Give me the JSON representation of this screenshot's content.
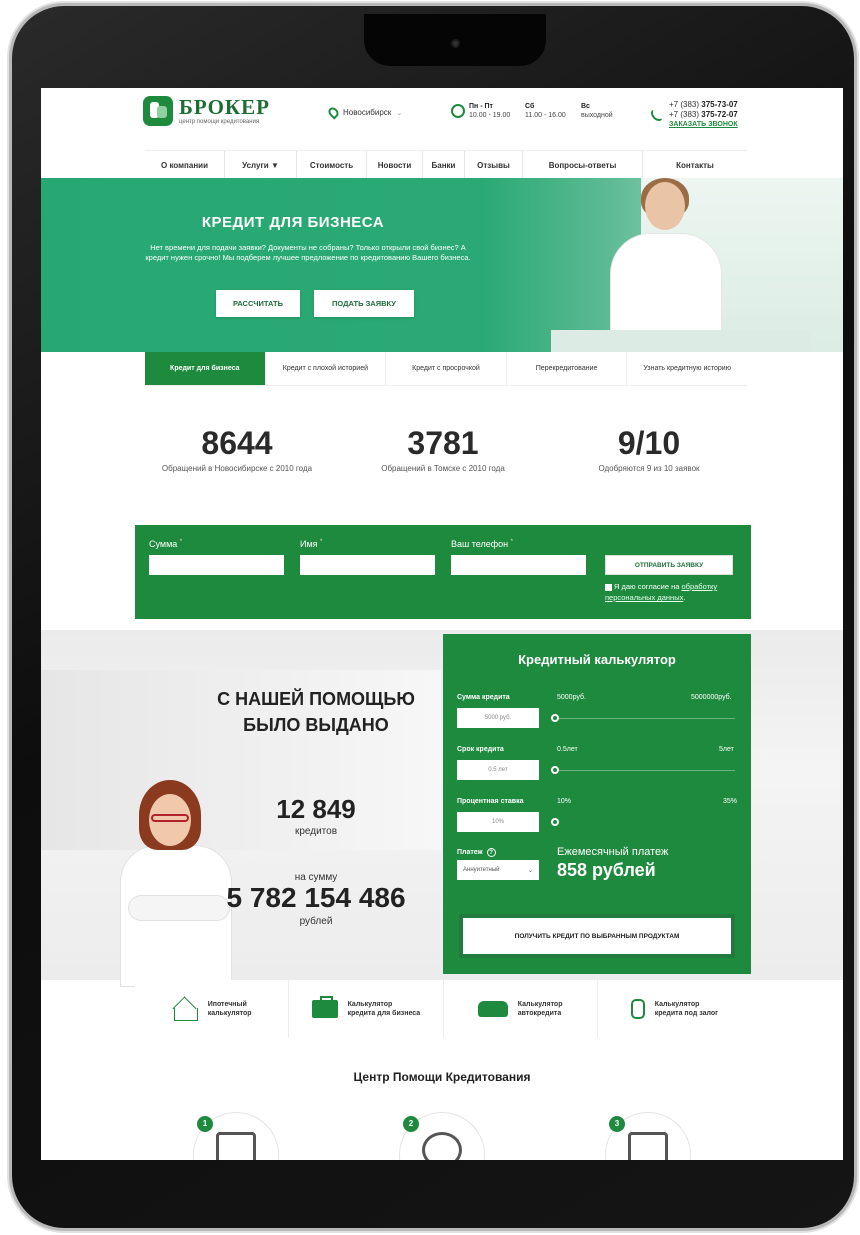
{
  "header": {
    "logo_name": "БРОКЕР",
    "logo_sub": "центр помощи кредитования",
    "city": "Новосибирск",
    "schedule": [
      {
        "day": "Пн - Пт",
        "hours": "10.00 - 19.00"
      },
      {
        "day": "Сб",
        "hours": "11.00 - 16.00"
      },
      {
        "day": "Вс",
        "hours": "выходной"
      }
    ],
    "phone1_prefix": "+7 (383)",
    "phone1": "375-73-07",
    "phone2_prefix": "+7 (383)",
    "phone2": "375-72-07",
    "callback": "ЗАКАЗАТЬ ЗВОНОК"
  },
  "nav": [
    "О компании",
    "Услуги ▼",
    "Стоимость",
    "Новости",
    "Банки",
    "Отзывы",
    "Вопросы-ответы",
    "Контакты"
  ],
  "hero": {
    "title": "КРЕДИТ ДЛЯ БИЗНЕСА",
    "text": "Нет времени для подачи заявки? Документы не собраны? Только открыли свой бизнес? А кредит нужен срочно! Мы подберем лучшее предложение по кредитованию Вашего бизнеса.",
    "btn_calc": "РАССЧИТАТЬ",
    "btn_apply": "ПОДАТЬ ЗАЯВКУ"
  },
  "tabs": [
    "Кредит для бизнеса",
    "Кредит с плохой историей",
    "Кредит с просрочкой",
    "Перекредитование",
    "Узнать кредитную историю"
  ],
  "stats": [
    {
      "num": "8644",
      "label": "Обращений в Новосибирске с 2010 года"
    },
    {
      "num": "3781",
      "label": "Обращений в Томске с 2010 года"
    },
    {
      "num": "9/10",
      "label": "Одобряются 9 из 10 заявок"
    }
  ],
  "form": {
    "sum_label": "Сумма",
    "name_label": "Имя",
    "phone_label": "Ваш телефон",
    "required": "*",
    "submit": "ОТПРАВИТЬ ЗАЯВКУ",
    "agree_text": "Я даю согласие на ",
    "agree_link": "обработку персональных данных",
    "agree_end": "."
  },
  "issued": {
    "title": "С НАШЕЙ ПОМОЩЬЮ БЫЛО ВЫДАНО",
    "credits_num": "12 849",
    "credits_lbl": "кредитов",
    "sum_lbl": "на сумму",
    "sum_num": "5 782 154 486",
    "rub_lbl": "рублей"
  },
  "calc": {
    "title": "Кредитный калькулятор",
    "amount_label": "Сумма кредита",
    "amount_min": "5000руб.",
    "amount_max": "5000000руб.",
    "amount_value": "5000 руб.",
    "term_label": "Срок кредита",
    "term_min": "0.5лет",
    "term_max": "5лет",
    "term_value": "0.5 лет",
    "rate_label": "Процентная ставка",
    "rate_min": "10%",
    "rate_max": "35%",
    "rate_value": "10%",
    "payment_label": "Платеж",
    "payment_type": "Аннуитетный",
    "monthly_label": "Ежемесячный платеж",
    "monthly_value": "858 рублей",
    "cta": "ПОЛУЧИТЬ КРЕДИТ ПО ВЫБРАННЫМ ПРОДУКТАМ"
  },
  "bottom_links": [
    {
      "l1": "Ипотечный",
      "l2": "калькулятор",
      "icon": "house-icon"
    },
    {
      "l1": "Калькулятор",
      "l2": "кредита для бизнеса",
      "icon": "briefcase-icon"
    },
    {
      "l1": "Калькулятор",
      "l2": "автокредита",
      "icon": "car-icon"
    },
    {
      "l1": "Калькулятор",
      "l2": "кредита под залог",
      "icon": "watch-icon"
    }
  ],
  "center": {
    "title": "Центр Помощи Кредитования",
    "steps": [
      "1",
      "2",
      "3"
    ]
  },
  "colors": {
    "accent": "#1e8a3e",
    "hero": "#2aa974"
  }
}
